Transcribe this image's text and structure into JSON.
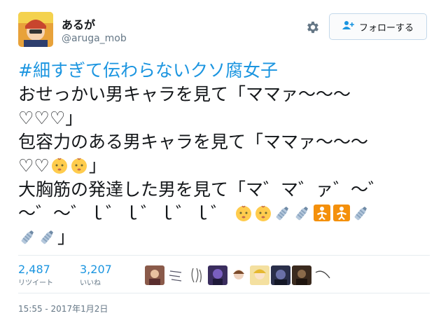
{
  "user": {
    "display_name": "あるが",
    "handle": "@aruga_mob"
  },
  "follow_button": {
    "label": "フォローする"
  },
  "tweet": {
    "hashtag": "#細すぎて伝わらないクソ腐女子",
    "lines": [
      "おせっかい男キャラを見て「ママァ～～～",
      "♡♡♡」",
      "包容力のある男キャラを見て「ママァ～～～",
      "♡♡",
      "」",
      "大胸筋の発達した男を見て「マ゛マ゛ァ゛～゛",
      "～゛～゛ｌ゛ｌ゛ｌ゛ｌ゛",
      "」"
    ]
  },
  "stats": {
    "retweets": {
      "count": "2,487",
      "label": "リツイート"
    },
    "likes": {
      "count": "3,207",
      "label": "いいね"
    }
  },
  "timestamp": "15:55 - 2017年1月2日",
  "colors": {
    "accent": "#1b95e0",
    "muted": "#657786",
    "text": "#14171a",
    "divider": "#e6ecf0"
  },
  "icons": [
    "settings-gear-icon",
    "follow-person-plus-icon",
    "baby-emoji",
    "baby-bottle-emoji",
    "restroom-baby-symbol-emoji"
  ]
}
